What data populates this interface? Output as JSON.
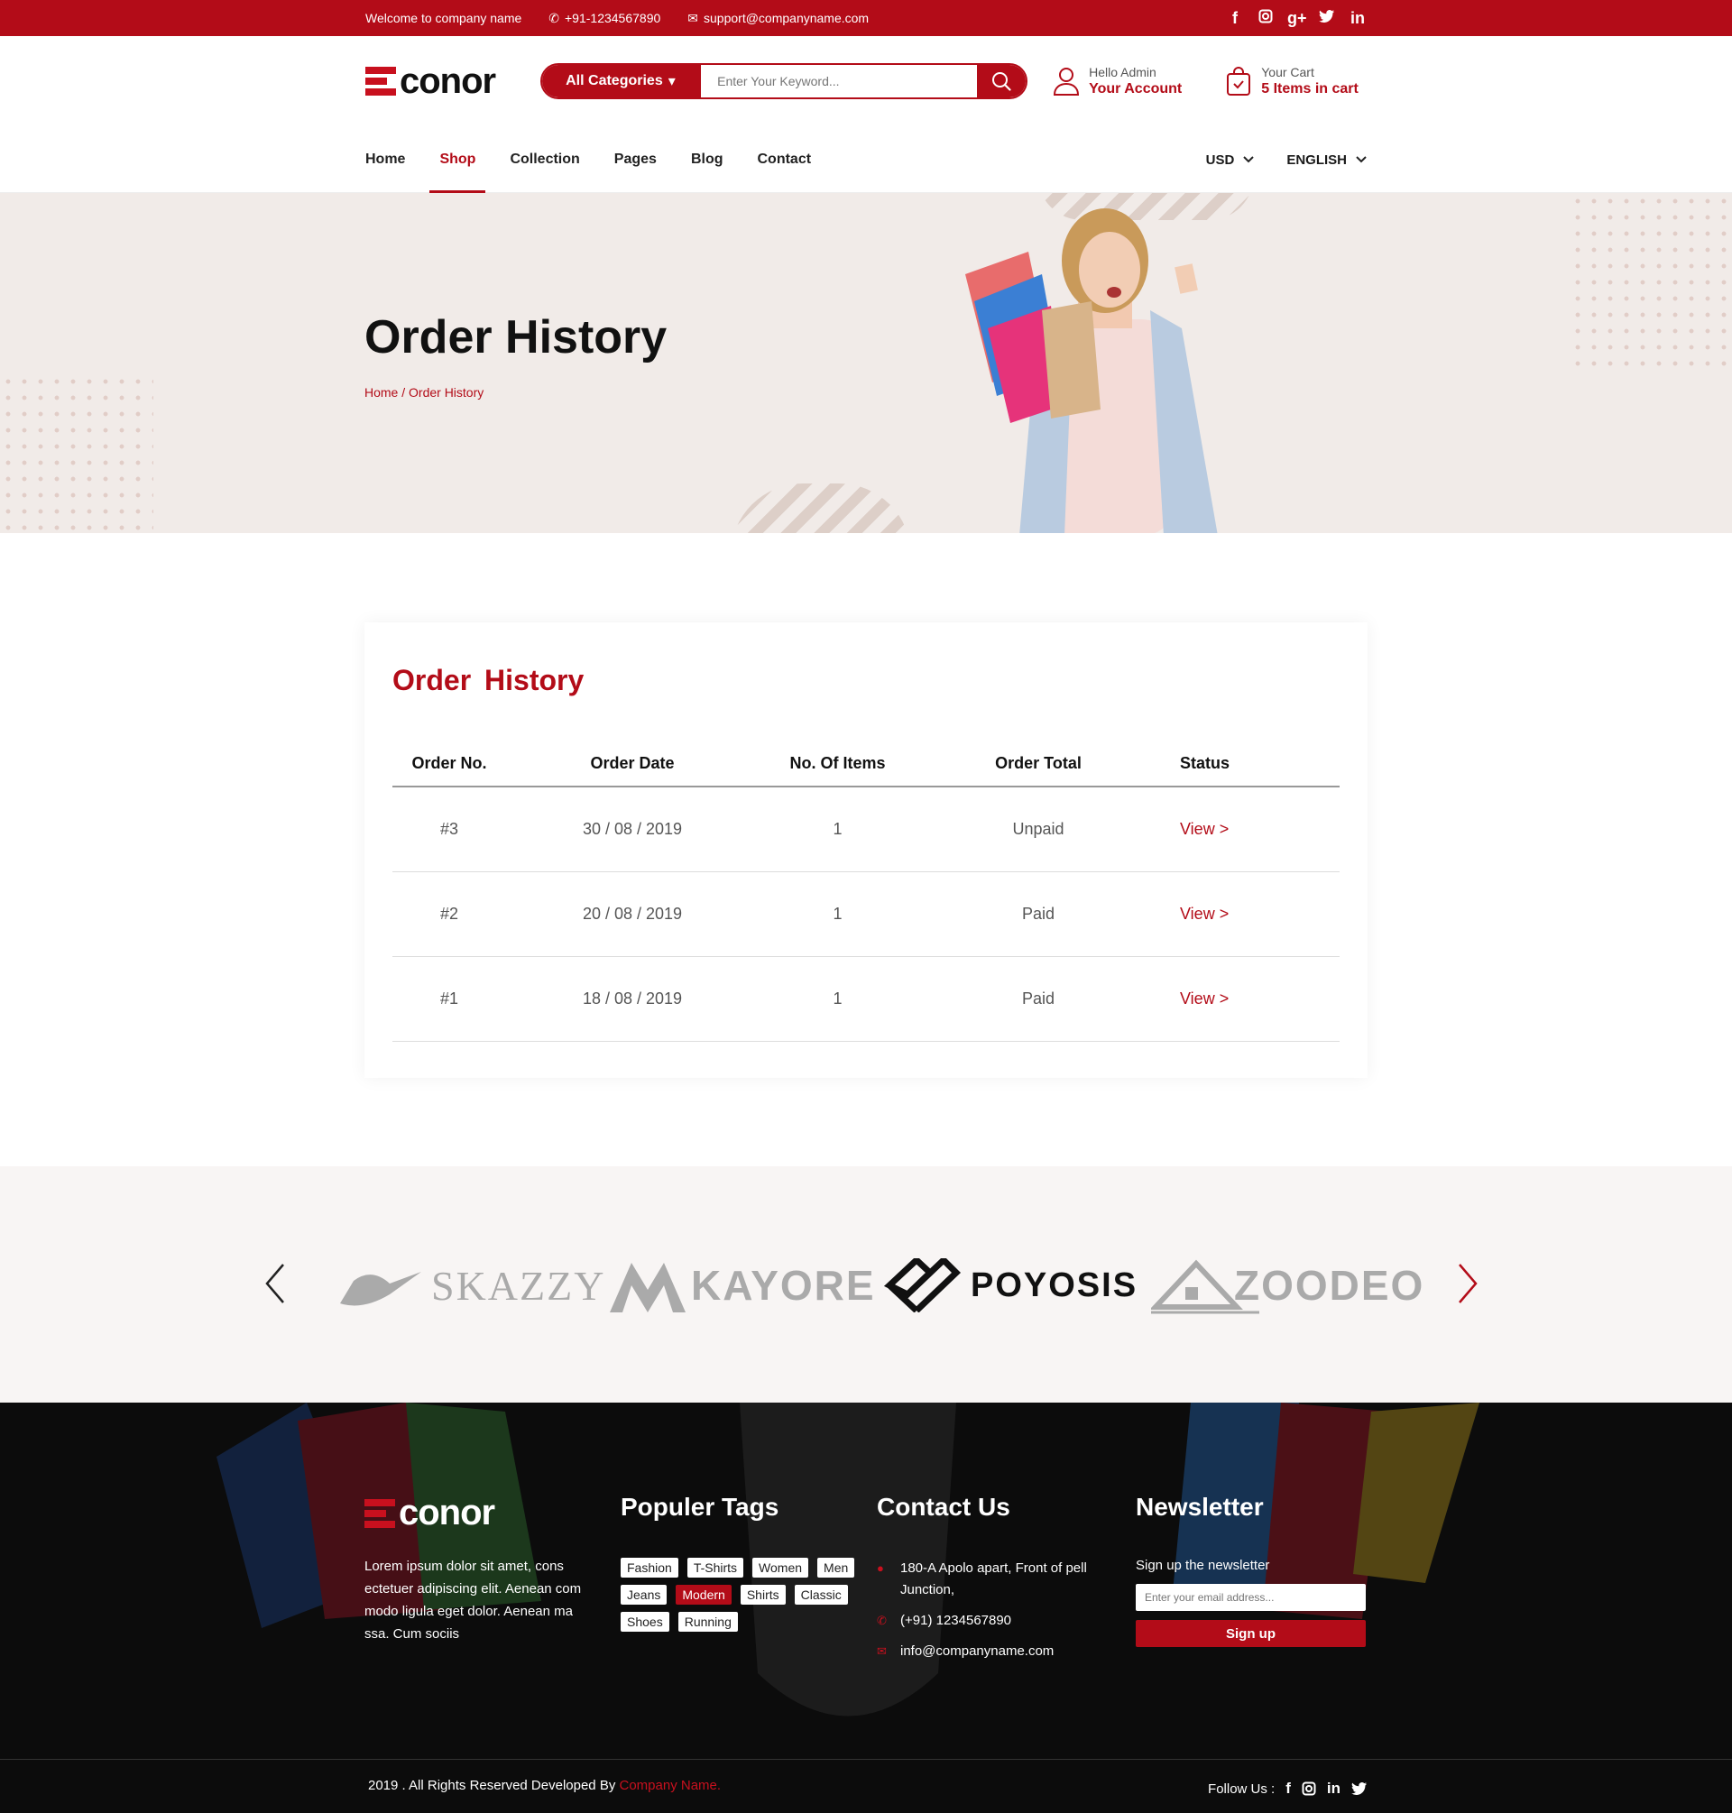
{
  "topbar": {
    "welcome": "Welcome to company name",
    "phone": "+91-1234567890",
    "email": "support@companyname.com",
    "socials": [
      "f",
      "ig",
      "g+",
      "tw",
      "in"
    ]
  },
  "header": {
    "logo": "conor",
    "search": {
      "category": "All Categories",
      "placeholder": "Enter Your Keyword..."
    },
    "account": {
      "greeting": "Hello Admin",
      "label": "Your Account"
    },
    "cart": {
      "label": "Your Cart",
      "count": "5 Items in cart"
    }
  },
  "nav": {
    "items": [
      "Home",
      "Shop",
      "Collection",
      "Pages",
      "Blog",
      "Contact"
    ],
    "active": "Shop",
    "currency": "USD",
    "language": "ENGLISH"
  },
  "hero": {
    "title": "Order History",
    "breadcrumb": "Home / Order History"
  },
  "orders": {
    "title": "Order  History",
    "columns": [
      "Order No.",
      "Order Date",
      "No. Of Items",
      "Order Total",
      "Status"
    ],
    "rows": [
      {
        "no": "#3",
        "date": "30 / 08 / 2019",
        "items": "1",
        "total": "Unpaid",
        "status": "View >"
      },
      {
        "no": "#2",
        "date": "20 / 08 / 2019",
        "items": "1",
        "total": "Paid",
        "status": "View >"
      },
      {
        "no": "#1",
        "date": "18 / 08 / 2019",
        "items": "1",
        "total": "Paid",
        "status": "View >"
      }
    ]
  },
  "brands": [
    "SKAZZY",
    "KAYORE",
    "POYOSIS",
    "ZOODEO"
  ],
  "footer": {
    "logo": "conor",
    "about": "Lorem ipsum dolor sit amet, cons ectetuer adipiscing elit. Aenean com modo ligula eget dolor. Aenean ma ssa. Cum sociis",
    "tags_title": "Populer Tags",
    "tags": [
      "Fashion",
      "T-Shirts",
      "Women",
      "Men",
      "Jeans",
      "Modern",
      "Shirts",
      "Classic",
      "Shoes",
      "Running"
    ],
    "active_tag": "Modern",
    "contact_title": "Contact Us",
    "address": "180-A Apolo apart, Front of pell Junction,",
    "phone": "(+91) 1234567890",
    "email": "info@companyname.com",
    "newsletter_title": "Newsletter",
    "newsletter_text": "Sign up the newsletter",
    "newsletter_placeholder": "Enter your email address...",
    "signup": "Sign up",
    "copyright": "2019 . All Rights Reserved Developed By",
    "company": "Company Name.",
    "follow": "Follow Us :",
    "follow_socials": [
      "f",
      "ig",
      "in",
      "tw"
    ]
  },
  "colors": {
    "brand": "#b30c18",
    "hero_bg": "#f1ebe8",
    "footer_bg": "#0c0c0c"
  }
}
